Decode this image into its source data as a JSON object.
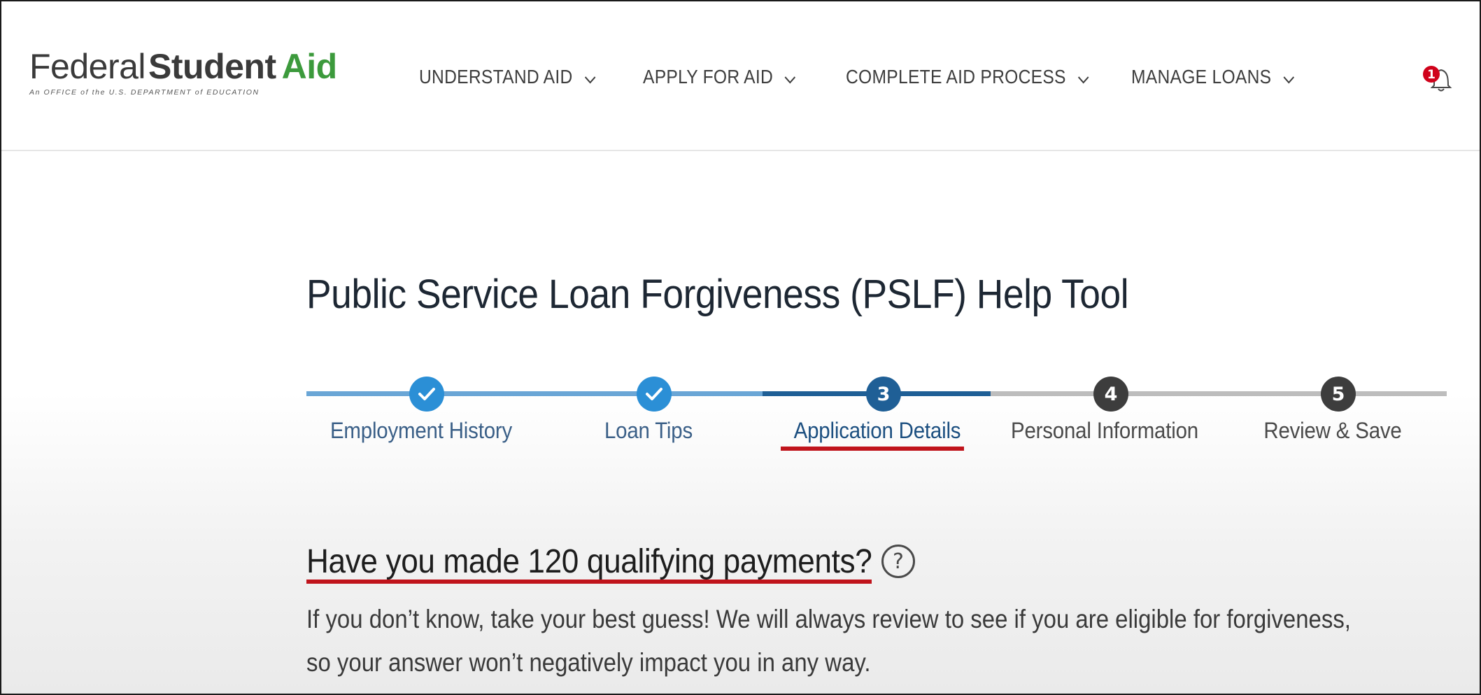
{
  "logo": {
    "word1": "Federal",
    "word2": "Student",
    "word3": "Aid",
    "tagline": "An OFFICE of the U.S. DEPARTMENT of EDUCATION",
    "colors": {
      "text": "#3a3a3a",
      "accent": "#3c9a3c"
    }
  },
  "nav": {
    "items": [
      {
        "label": "UNDERSTAND AID",
        "icon": "chevron-down-icon"
      },
      {
        "label": "APPLY FOR AID",
        "icon": "chevron-down-icon"
      },
      {
        "label": "COMPLETE AID PROCESS",
        "icon": "chevron-down-icon"
      },
      {
        "label": "MANAGE LOANS",
        "icon": "chevron-down-icon"
      }
    ],
    "notifications": {
      "count": "1",
      "icon": "bell-icon",
      "badge_color": "#d0021b"
    }
  },
  "page": {
    "title": "Public Service Loan Forgiveness (PSLF) Help Tool"
  },
  "stepper": {
    "steps": [
      {
        "label": "Employment History",
        "status": "complete",
        "icon": "check-icon"
      },
      {
        "label": "Loan Tips",
        "status": "complete",
        "icon": "check-icon"
      },
      {
        "label": "Application Details",
        "status": "current",
        "number": "3"
      },
      {
        "label": "Personal Information",
        "status": "upcoming",
        "number": "4"
      },
      {
        "label": "Review & Save",
        "status": "upcoming",
        "number": "5"
      }
    ],
    "colors": {
      "complete": "#2b8fd6",
      "current": "#1f5f96",
      "upcoming": "#3d3d3d",
      "track_complete": "#6aa6d6",
      "track_current": "#1f5f96",
      "track_upcoming": "#bdbdbd"
    }
  },
  "question": {
    "text": "Have you made 120 qualifying payments?",
    "help_icon": "question-circle-icon",
    "help_glyph": "?",
    "description_line1": "If you don’t know, take your best guess! We will always review to see if you are eligible for forgiveness,",
    "description_line2": "so your answer won’t negatively impact you in any way."
  },
  "annotation": {
    "underline_color": "#c0141c"
  }
}
